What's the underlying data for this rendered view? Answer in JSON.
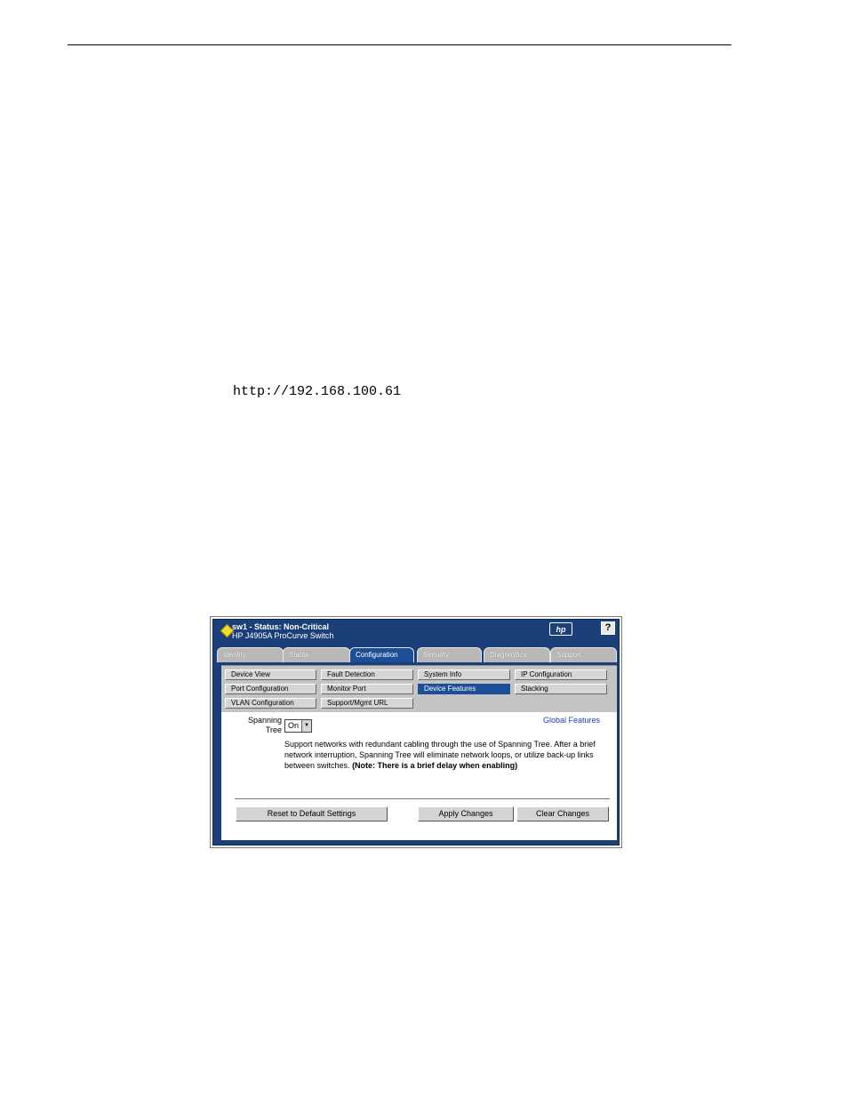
{
  "document": {
    "url": "http://192.168.100.61"
  },
  "window": {
    "title": "sw1 - Status: Non-Critical",
    "subtitle": "HP J4905A ProCurve Switch",
    "logo_text": "hp",
    "help_label": "?",
    "status_color": "#f6dc2a"
  },
  "tabs": [
    {
      "label": "Identity",
      "active": false
    },
    {
      "label": "Status",
      "active": false
    },
    {
      "label": "Configuration",
      "active": true
    },
    {
      "label": "Security",
      "active": false
    },
    {
      "label": "Diagnostics",
      "active": false
    },
    {
      "label": "Support",
      "active": false
    }
  ],
  "submenu": {
    "items": [
      {
        "label": "Device View"
      },
      {
        "label": "Fault Detection"
      },
      {
        "label": "System Info"
      },
      {
        "label": "IP Configuration"
      },
      {
        "label": "Port Configuration"
      },
      {
        "label": "Monitor Port"
      },
      {
        "label": "Device Features",
        "active": true
      },
      {
        "label": "Stacking"
      },
      {
        "label": "VLAN Configuration"
      },
      {
        "label": "Support/Mgmt URL"
      }
    ]
  },
  "content": {
    "section_title": "Global Features",
    "spanning_tree_label": "Spanning Tree",
    "spanning_tree_label_line1": "Spanning",
    "spanning_tree_label_line2": "Tree",
    "spanning_tree_value": "On",
    "description": "Support networks with redundant cabling through the use of Spanning Tree. After a brief network interruption, Spanning Tree will eliminate network loops, or utilize back-up links between switches.",
    "note": "(Note: There is a brief delay when enabling)"
  },
  "buttons": {
    "reset": "Reset to Default Settings",
    "apply": "Apply Changes",
    "clear": "Clear Changes"
  },
  "colors": {
    "frame_blue": "#1b3f78",
    "active_blue": "#1d4f98",
    "link_blue": "#1c3fb6"
  }
}
